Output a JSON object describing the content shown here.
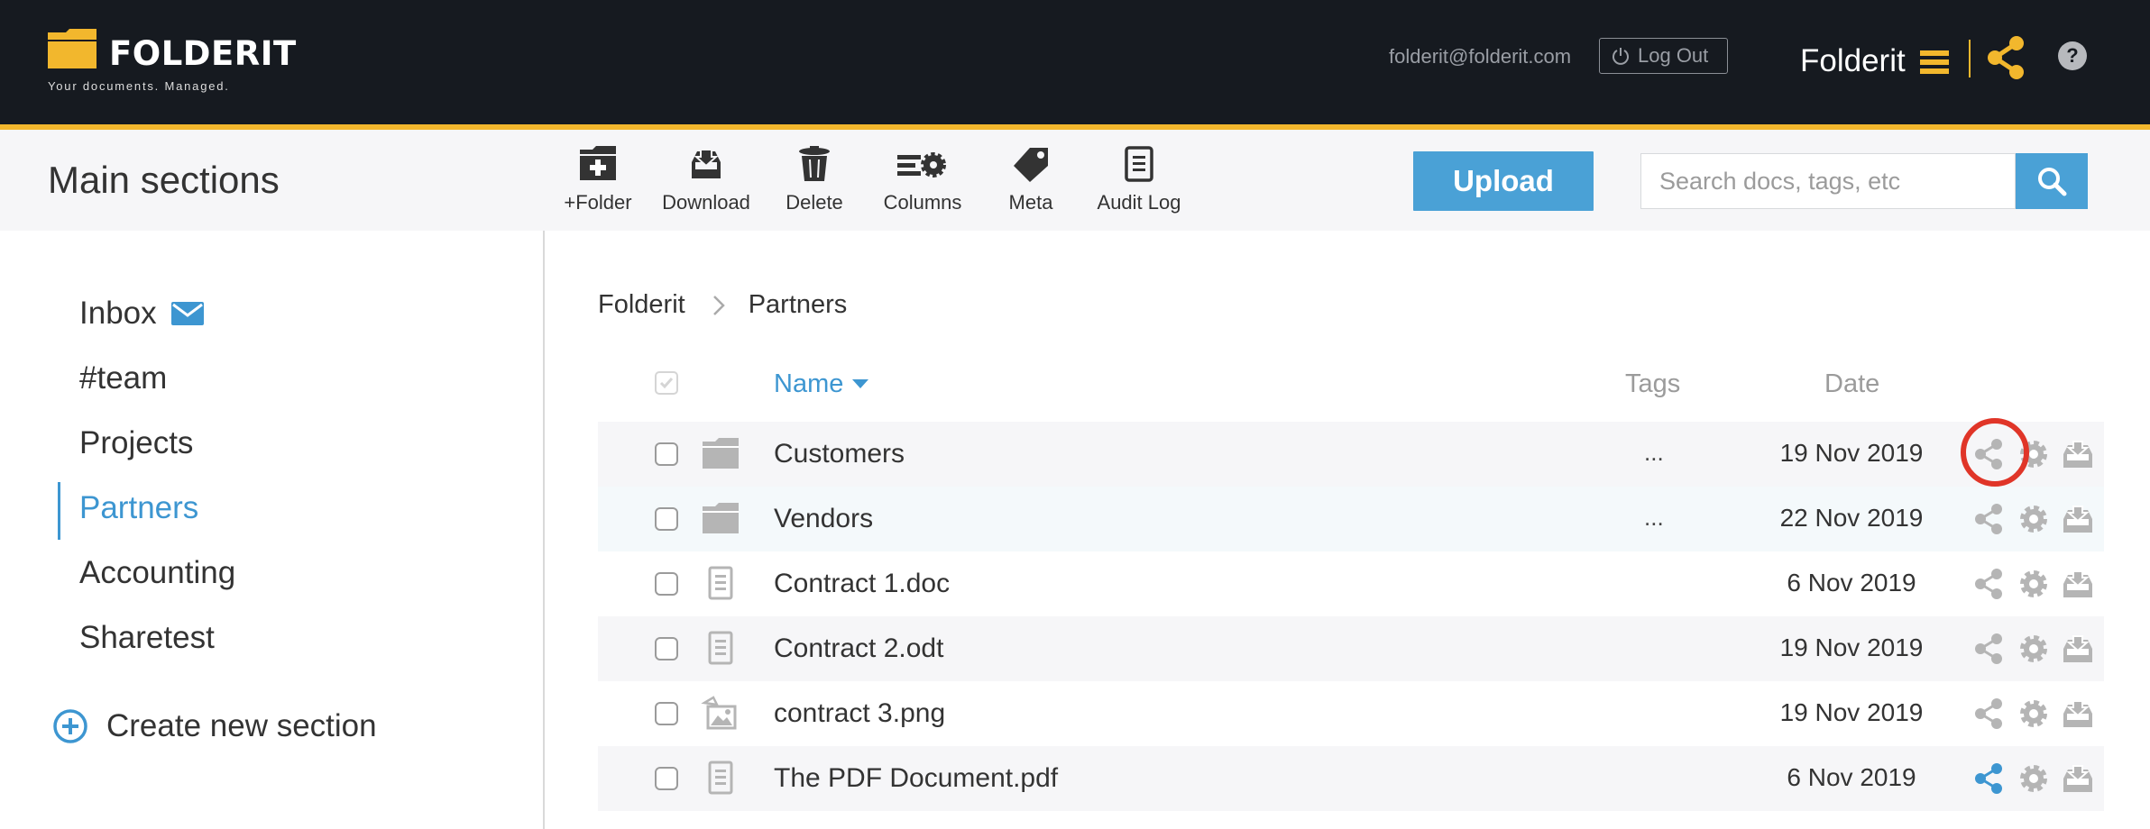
{
  "header": {
    "brand": "FOLDERIT",
    "tagline": "Your documents. Managed.",
    "email": "folderit@folderit.com",
    "logout_label": "Log Out",
    "account_name": "Folderit",
    "help_label": "?",
    "accent_color": "#f2b72d"
  },
  "toolbar": {
    "title": "Main sections",
    "actions": [
      {
        "label": "+Folder",
        "icon": "folder-plus-icon"
      },
      {
        "label": "Download",
        "icon": "download-tray-icon"
      },
      {
        "label": "Delete",
        "icon": "trash-icon"
      },
      {
        "label": "Columns",
        "icon": "columns-gear-icon"
      },
      {
        "label": "Meta",
        "icon": "tag-icon"
      },
      {
        "label": "Audit Log",
        "icon": "document-list-icon"
      }
    ],
    "upload_label": "Upload",
    "search_placeholder": "Search docs, tags, etc",
    "search_value": ""
  },
  "sidebar": {
    "items": [
      {
        "label": "Inbox",
        "active": false
      },
      {
        "label": "#team",
        "active": false
      },
      {
        "label": "Projects",
        "active": false
      },
      {
        "label": "Partners",
        "active": true
      },
      {
        "label": "Accounting",
        "active": false
      },
      {
        "label": "Sharetest",
        "active": false
      }
    ],
    "create_label": "Create new section"
  },
  "breadcrumb": [
    "Folderit",
    "Partners"
  ],
  "table": {
    "columns": {
      "name": "Name",
      "tags": "Tags",
      "date": "Date"
    },
    "rows": [
      {
        "type": "folder",
        "name": "Customers",
        "tags": "...",
        "date": "19 Nov 2019"
      },
      {
        "type": "folder",
        "name": "Vendors",
        "tags": "...",
        "date": "22 Nov 2019"
      },
      {
        "type": "document",
        "name": "Contract 1.doc",
        "tags": "",
        "date": "6 Nov 2019"
      },
      {
        "type": "document",
        "name": "Contract 2.odt",
        "tags": "",
        "date": "19 Nov 2019"
      },
      {
        "type": "image",
        "name": "contract 3.png",
        "tags": "",
        "date": "19 Nov 2019"
      },
      {
        "type": "document",
        "name": "The PDF Document.pdf",
        "tags": "",
        "date": "6 Nov 2019",
        "shared": true
      }
    ]
  },
  "colors": {
    "link_blue": "#3d96d1",
    "button_blue": "#4aa1d6",
    "highlight_red": "#e03528",
    "icon_gray": "#b5b5b5"
  }
}
